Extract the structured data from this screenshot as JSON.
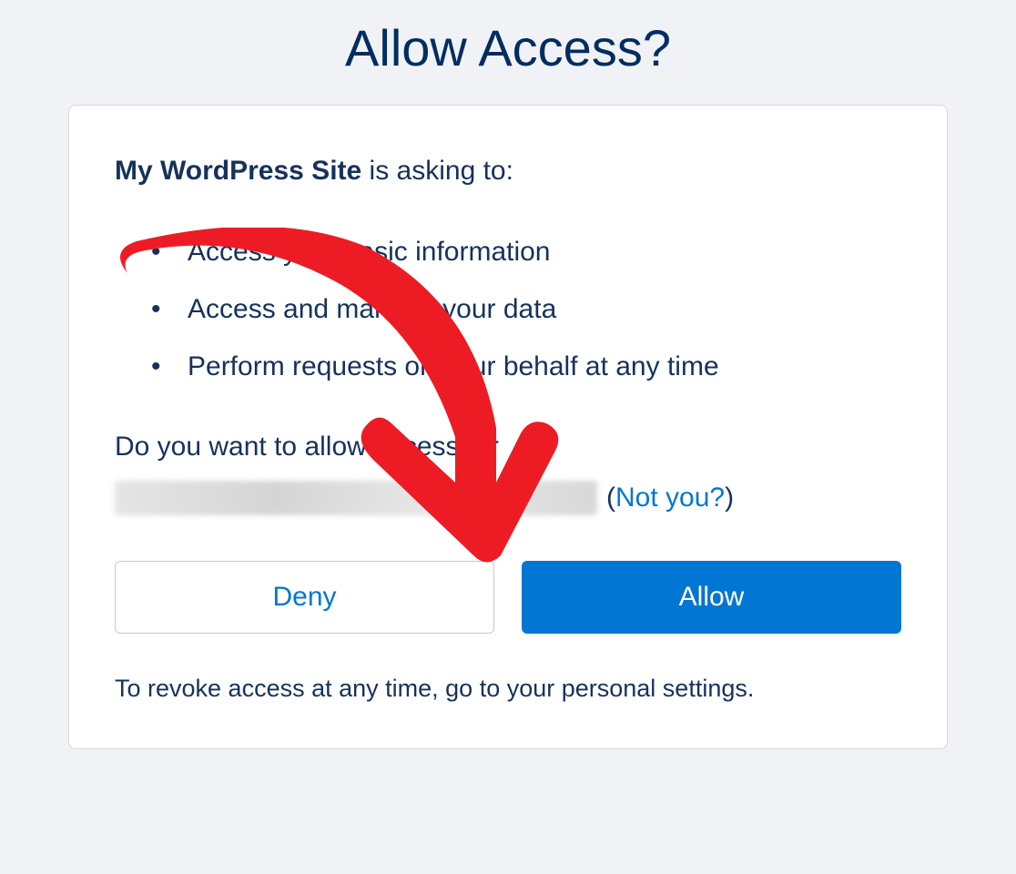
{
  "page_title": "Allow Access?",
  "app_name": "My WordPress Site",
  "asking_text": " is asking to:",
  "permissions": [
    "Access your basic information",
    "Access and manage your data",
    "Perform requests on your behalf at any time"
  ],
  "allow_question": "Do you want to allow access for",
  "not_you_prefix": "(",
  "not_you_link": "Not you?",
  "not_you_suffix": ")",
  "deny_label": "Deny",
  "allow_label": "Allow",
  "revoke_text": "To revoke access at any time, go to your personal settings.",
  "annotation": {
    "type": "red-arrow",
    "target": "allow-button"
  }
}
